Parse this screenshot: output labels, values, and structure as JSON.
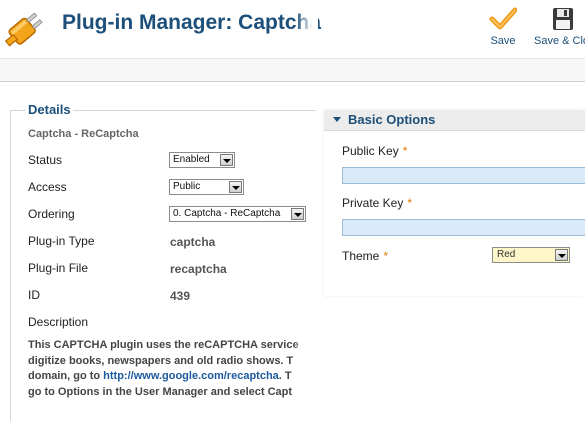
{
  "header": {
    "title": "Plug-in Manager: Captcha",
    "logo_icon": "plug-icon"
  },
  "toolbar": {
    "save_label": "Save",
    "save_icon": "checkmark-icon",
    "save_close_label": "Save & Close",
    "save_close_icon": "floppy-disk-icon",
    "accent": "#f29b1d"
  },
  "details": {
    "legend": "Details",
    "plugin_name": "Captcha - ReCaptcha",
    "status_label": "Status",
    "status_value": "Enabled",
    "access_label": "Access",
    "access_value": "Public",
    "ordering_label": "Ordering",
    "ordering_value": "0. Captcha - ReCaptcha",
    "type_label": "Plug-in Type",
    "type_value": "captcha",
    "file_label": "Plug-in File",
    "file_value": "recaptcha",
    "id_label": "ID",
    "id_value": "439",
    "description_label": "Description",
    "description_line1": "This CAPTCHA plugin uses the reCAPTCHA service",
    "description_line2": "digitize books, newspapers and old radio shows. T",
    "description_line3_prefix": "domain, go to ",
    "description_link": "http://www.google.com/recaptcha",
    "description_line3_suffix": ". T",
    "description_line4": "go to Options in the User Manager and select Capt"
  },
  "basic_options": {
    "title": "Basic Options",
    "public_key_label": "Public Key",
    "public_key_value": "",
    "private_key_label": "Private Key",
    "private_key_value": "",
    "theme_label": "Theme",
    "theme_value": "Red",
    "required_marker": "*"
  },
  "colors": {
    "title_blue": "#1c4f79",
    "input_bg": "#d9ebfa",
    "required": "#e07b00"
  }
}
